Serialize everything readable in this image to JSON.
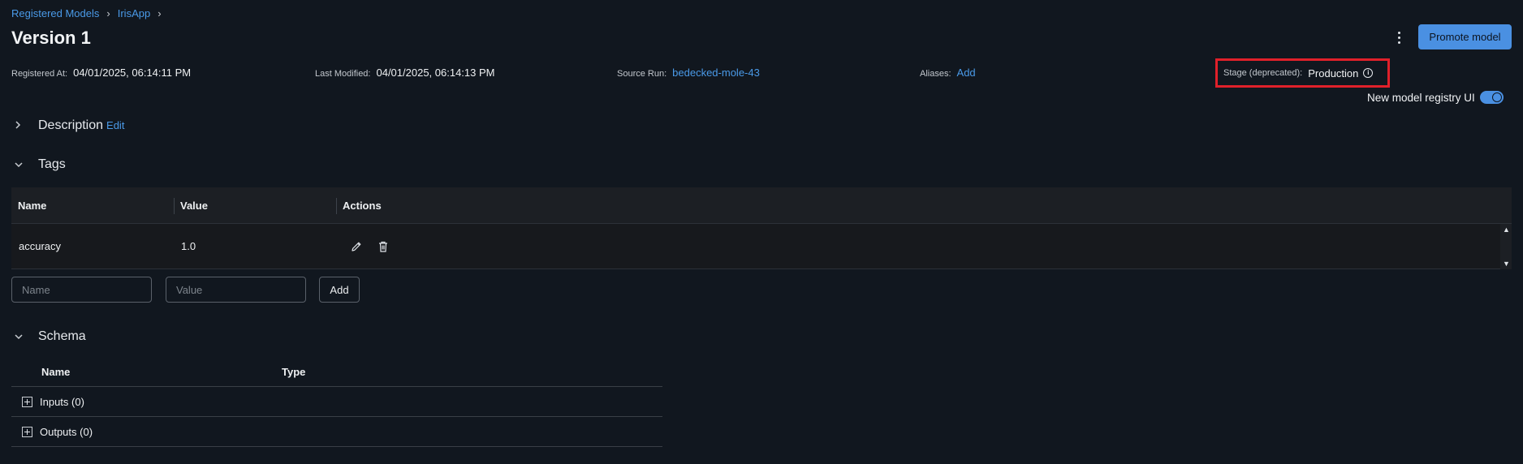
{
  "breadcrumb": {
    "items": [
      "Registered Models",
      "IrisApp"
    ],
    "separator": "›"
  },
  "title": "Version 1",
  "header": {
    "promote_label": "Promote model"
  },
  "meta": {
    "registered_label": "Registered At:",
    "registered_value": "04/01/2025, 06:14:11 PM",
    "modified_label": "Last Modified:",
    "modified_value": "04/01/2025, 06:14:13 PM",
    "source_label": "Source Run:",
    "source_value": "bedecked-mole-43",
    "aliases_label": "Aliases:",
    "aliases_add": "Add",
    "stage_label": "Stage (deprecated):",
    "stage_value": "Production"
  },
  "toggle": {
    "label": "New model registry UI",
    "on": true
  },
  "sections": {
    "description": "Description",
    "description_edit": "Edit",
    "tags": "Tags",
    "schema": "Schema"
  },
  "tags_table": {
    "headers": [
      "Name",
      "Value",
      "Actions"
    ],
    "rows": [
      {
        "name": "accuracy",
        "value": "1.0"
      }
    ]
  },
  "tag_form": {
    "name_placeholder": "Name",
    "value_placeholder": "Value",
    "add_label": "Add"
  },
  "schema_table": {
    "headers": [
      "Name",
      "Type"
    ],
    "rows": [
      "Inputs (0)",
      "Outputs (0)"
    ]
  },
  "colors": {
    "accent": "#4a90e2",
    "highlight_border": "#e0202a",
    "background": "#11171f"
  }
}
